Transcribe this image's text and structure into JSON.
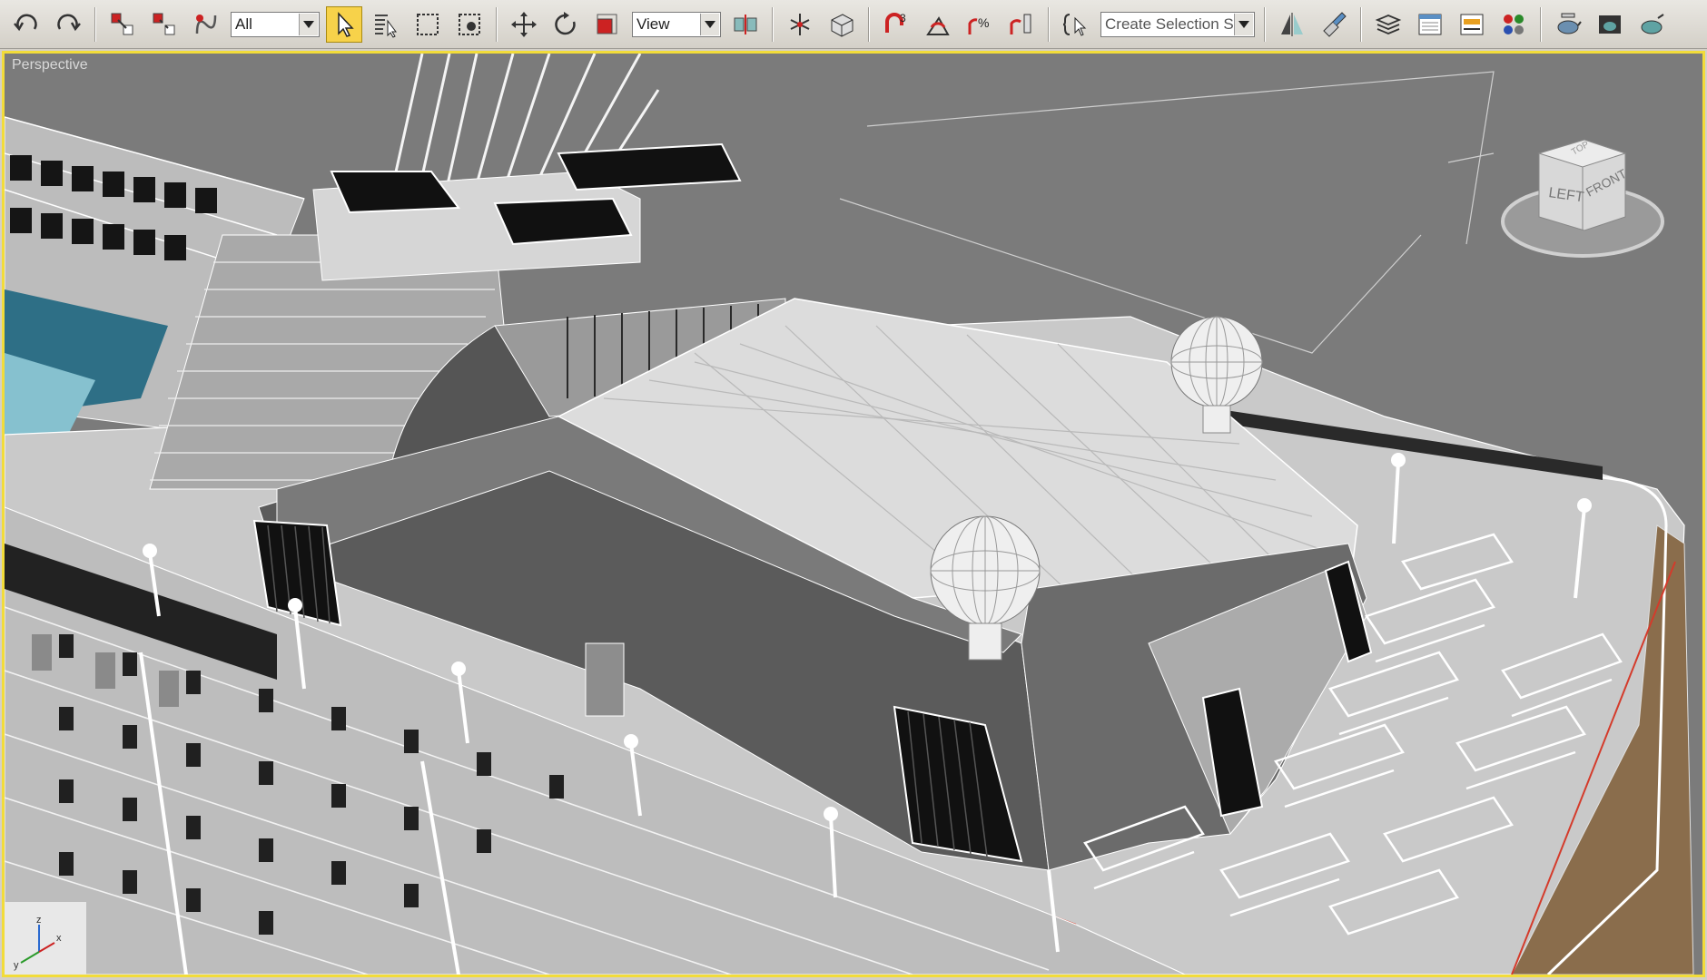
{
  "toolbar": {
    "selection_filter": "All",
    "coordinate_system": "View",
    "named_selection_set_placeholder": "Create Selection Set",
    "snap_angle_label": "3",
    "percent_snap_label": "%"
  },
  "viewport": {
    "label": "Perspective",
    "viewcube": {
      "top": "TOP",
      "left": "LEFT",
      "front": "FRONT"
    },
    "axis_tripod": {
      "x": "x",
      "y": "y",
      "z": "z"
    }
  },
  "icons": [
    "undo-icon",
    "redo-icon",
    "select-and-link-icon",
    "unlink-selection-icon",
    "bind-to-space-warp-icon",
    "select-object-icon",
    "select-by-name-icon",
    "rectangular-selection-icon",
    "window-crossing-icon",
    "select-and-move-icon",
    "select-and-rotate-icon",
    "select-and-scale-icon",
    "pivot-center-icon",
    "select-and-manipulate-icon",
    "keyboard-shortcut-override-icon",
    "snaps-toggle-icon",
    "angle-snap-icon",
    "percent-snap-icon",
    "spinner-snap-icon",
    "edit-named-selection-icon",
    "mirror-icon",
    "align-icon",
    "layer-manager-icon",
    "graphite-ribbon-icon",
    "curve-editor-icon",
    "schematic-view-icon",
    "material-editor-icon",
    "render-setup-icon",
    "rendered-frame-window-icon",
    "render-production-icon"
  ],
  "colors": {
    "active_viewport_border": "#f2dc3a",
    "active_tool": "#f7d24a",
    "viewport_background": "#7b7b7b",
    "toolbar_background": "#d4d0c8"
  }
}
